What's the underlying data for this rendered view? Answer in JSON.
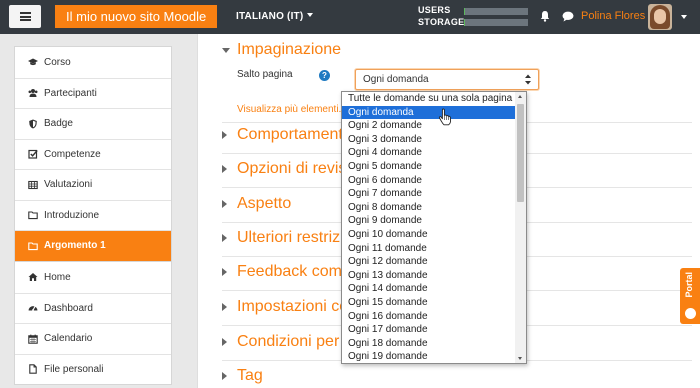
{
  "header": {
    "menu_icon": "hamburger-icon",
    "site_name": "Il mio nuovo sito Moodle",
    "language": "ITALIANO (IT)",
    "usage": [
      {
        "label": "USERS",
        "fill_fraction": 0.02
      },
      {
        "label": "STORAGE",
        "fill_fraction": 0.02
      }
    ],
    "notification_icon": "bell-icon",
    "messages_icon": "chat-icon",
    "user_name": "Polina Flores",
    "colors": {
      "navbar": "#343a40",
      "brand": "#f98012",
      "usage_fill": "#5cb85c"
    }
  },
  "sidebar": {
    "group1": [
      {
        "label": "Corso",
        "icon": "graduation-cap-icon"
      },
      {
        "label": "Partecipanti",
        "icon": "users-icon"
      },
      {
        "label": "Badge",
        "icon": "shield-icon"
      },
      {
        "label": "Competenze",
        "icon": "checkbox-icon"
      },
      {
        "label": "Valutazioni",
        "icon": "table-icon"
      },
      {
        "label": "Introduzione",
        "icon": "folder-icon"
      },
      {
        "label": "Argomento 1",
        "icon": "folder-icon",
        "active": true
      }
    ],
    "group2": [
      {
        "label": "Home",
        "icon": "home-icon"
      },
      {
        "label": "Dashboard",
        "icon": "dashboard-icon"
      },
      {
        "label": "Calendario",
        "icon": "calendar-icon"
      },
      {
        "label": "File personali",
        "icon": "file-icon"
      }
    ]
  },
  "form": {
    "section_open": "Impaginazione",
    "field_label": "Salto pagina",
    "help_icon": "question-circle-icon",
    "select_value": "Ogni domanda",
    "show_more": "Visualizza più elementi...",
    "sections": [
      "Comportamento",
      "Opzioni di revisio",
      "Aspetto",
      "Ulteriori restrizio",
      "Feedback comple",
      "Impostazioni com",
      "Condizioni per l'a",
      "Tag"
    ]
  },
  "dropdown": {
    "options": [
      "Tutte le domande su una sola pagina",
      "Ogni domanda",
      "Ogni 2 domande",
      "Ogni 3 domande",
      "Ogni 4 domande",
      "Ogni 5 domande",
      "Ogni 6 domande",
      "Ogni 7 domande",
      "Ogni 8 domande",
      "Ogni 9 domande",
      "Ogni 10 domande",
      "Ogni 11 domande",
      "Ogni 12 domande",
      "Ogni 13 domande",
      "Ogni 14 domande",
      "Ogni 15 domande",
      "Ogni 16 domande",
      "Ogni 17 domande",
      "Ogni 18 domande",
      "Ogni 19 domande"
    ],
    "selected_index": 1
  },
  "portal_tab": {
    "label": "Portal",
    "icon": "moodle-logo-icon"
  }
}
